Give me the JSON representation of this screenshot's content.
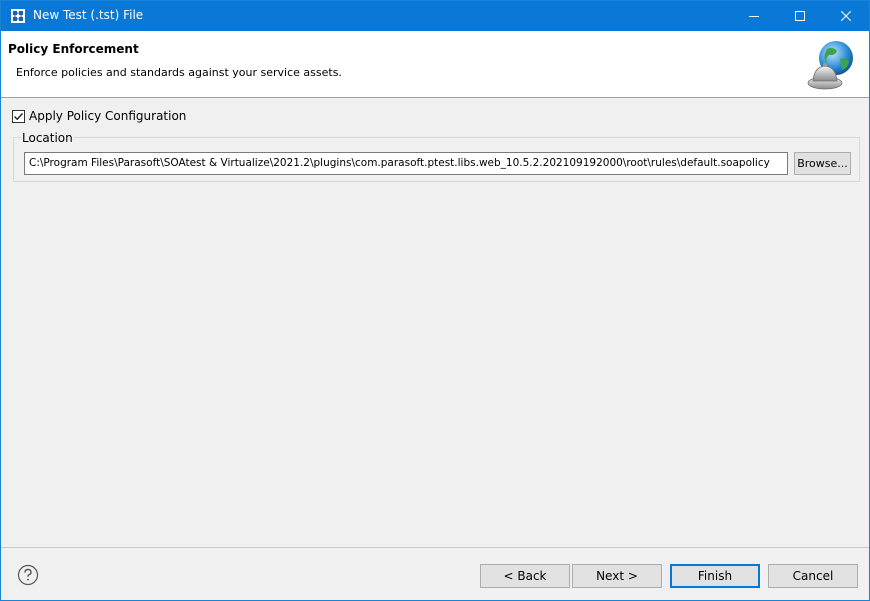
{
  "window": {
    "title": "New Test (.tst) File",
    "icons": {
      "app": "parasoft-app-icon",
      "minimize": "minimize-icon",
      "maximize": "maximize-icon",
      "close": "close-icon"
    },
    "titlebar_color": "#0a78d7"
  },
  "header": {
    "title": "Policy Enforcement",
    "description": "Enforce policies and standards against your service assets.",
    "logo_icon": "globe-bell-icon"
  },
  "policy": {
    "apply_label": "Apply Policy Configuration",
    "apply_checked": true,
    "location_label": "Location",
    "location_value": "C:\\Program Files\\Parasoft\\SOAtest & Virtualize\\2021.2\\plugins\\com.parasoft.ptest.libs.web_10.5.2.202109192000\\root\\rules\\default.soapolicy",
    "browse_label": "Browse..."
  },
  "footer": {
    "help_icon": "help-icon",
    "back_label": "< Back",
    "next_label": "Next >",
    "finish_label": "Finish",
    "cancel_label": "Cancel",
    "accent_color": "#0078d7"
  }
}
